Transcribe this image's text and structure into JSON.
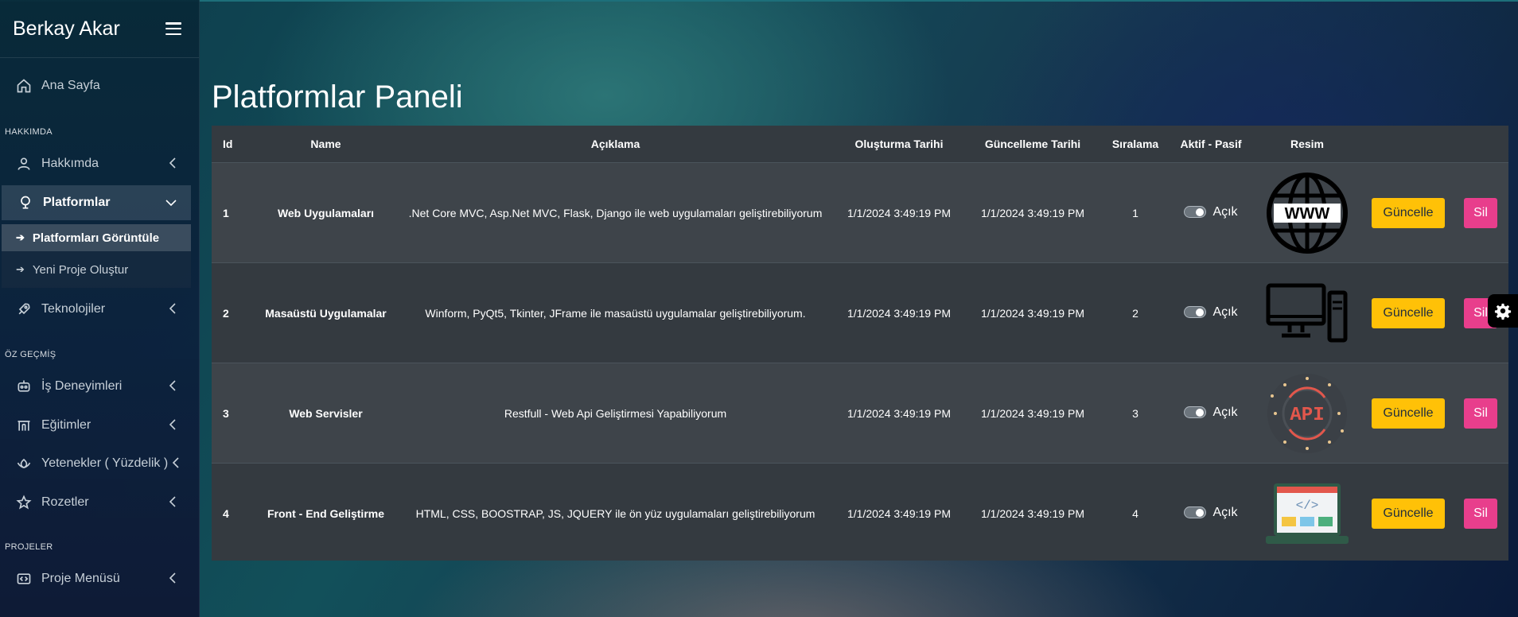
{
  "brand": {
    "name": "Berkay Akar"
  },
  "sidebar": {
    "items": [
      {
        "label": "Ana Sayfa",
        "icon": "home-icon"
      },
      {
        "label": "Hakkımda",
        "icon": "user-icon"
      },
      {
        "label": "Platformlar",
        "icon": "platform-icon"
      },
      {
        "label": "Teknolojiler",
        "icon": "rocket-icon"
      },
      {
        "label": "İş Deneyimleri",
        "icon": "robot-icon"
      },
      {
        "label": "Eğitimler",
        "icon": "school-icon"
      },
      {
        "label": "Yetenekler ( Yüzdelik )",
        "icon": "lotus-icon"
      },
      {
        "label": "Rozetler",
        "icon": "star-icon"
      },
      {
        "label": "Proje Menüsü",
        "icon": "code-icon"
      }
    ],
    "sections": [
      "HAKKIMDA",
      "ÖZ GEÇMİŞ",
      "PROJELER"
    ],
    "sub_items": [
      {
        "label": "Platformları Görüntüle"
      },
      {
        "label": "Yeni Proje Oluştur"
      }
    ]
  },
  "main": {
    "title": "Platformlar Paneli",
    "columns": [
      "Id",
      "Name",
      "Açıklama",
      "Oluşturma Tarihi",
      "Güncelleme Tarihi",
      "Sıralama",
      "Aktif - Pasif",
      "Resim"
    ],
    "rows": [
      {
        "id": "1",
        "name": "Web Uygulamaları",
        "desc": ".Net Core MVC, Asp.Net MVC, Flask, Django ile web uygulamaları geliştirebiliyorum",
        "created": "1/1/2024 3:49:19 PM",
        "updated": "1/1/2024 3:49:19 PM",
        "order": "1",
        "status": "Açık",
        "image": "www-globe-icon"
      },
      {
        "id": "2",
        "name": "Masaüstü Uygulamalar",
        "desc": "Winform, PyQt5, Tkinter, JFrame ile masaüstü uygulamalar geliştirebiliyorum.",
        "created": "1/1/2024 3:49:19 PM",
        "updated": "1/1/2024 3:49:19 PM",
        "order": "2",
        "status": "Açık",
        "image": "desktop-computer-icon"
      },
      {
        "id": "3",
        "name": "Web Servisler",
        "desc": "Restfull - Web Api Geliştirmesi Yapabiliyorum",
        "created": "1/1/2024 3:49:19 PM",
        "updated": "1/1/2024 3:49:19 PM",
        "order": "3",
        "status": "Açık",
        "image": "api-icon"
      },
      {
        "id": "4",
        "name": "Front - End Geliştirme",
        "desc": "HTML, CSS, BOOSTRAP, JS, JQUERY ile ön yüz uygulamaları geliştirebiliyorum",
        "created": "1/1/2024 3:49:19 PM",
        "updated": "1/1/2024 3:49:19 PM",
        "order": "4",
        "status": "Açık",
        "image": "laptop-code-icon"
      }
    ],
    "buttons": {
      "update": "Güncelle",
      "delete": "Sil"
    },
    "api_label": "API"
  },
  "colors": {
    "update_button": "#ffc107",
    "delete_button": "#e83e8c",
    "table_bg": "#343a40"
  }
}
